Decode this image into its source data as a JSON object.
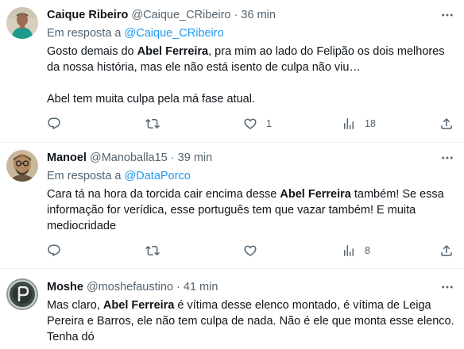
{
  "tweets": [
    {
      "name": "Caique Ribeiro",
      "handle": "@Caique_CRibeiro",
      "separator": "·",
      "time": "36 min",
      "reply_prefix": "Em resposta a",
      "reply_to": "@Caique_CRibeiro",
      "text_a": "Gosto demais do ",
      "text_bold": "Abel Ferreira",
      "text_b": ", pra mim ao lado do Felipão os dois melhores da nossa história, mas ele não está isento de culpa não viu…",
      "text_c": "Abel tem muita culpa pela má fase atual.",
      "reply_count": "",
      "retweet_count": "",
      "like_count": "1",
      "view_count": "18"
    },
    {
      "name": "Manoel",
      "handle": "@Manoballa15",
      "separator": "·",
      "time": "39 min",
      "reply_prefix": "Em resposta a",
      "reply_to": "@DataPorco",
      "text_a": "Cara tá na hora da torcida cair encima desse ",
      "text_bold": "Abel Ferreira",
      "text_b": " também! Se essa informação for verídica, esse português tem que vazar também! E muita mediocridade",
      "reply_count": "",
      "retweet_count": "",
      "like_count": "",
      "view_count": "8"
    },
    {
      "name": "Moshe",
      "handle": "@moshefaustino",
      "separator": "·",
      "time": "41 min",
      "text_a": "Mas claro, ",
      "text_bold": "Abel Ferreira",
      "text_b": " é vítima desse elenco montado, é vítima de Leiga Pereira e Barros, ele não tem culpa de nada. Não é ele que monta esse elenco. Tenha dó"
    }
  ],
  "colors": {
    "text": "#0f1419",
    "secondary": "#536471",
    "link": "#1d9bf0",
    "divider": "#eff3f4"
  },
  "icons": [
    "more-icon",
    "reply-icon",
    "retweet-icon",
    "like-icon",
    "views-icon",
    "share-icon"
  ]
}
